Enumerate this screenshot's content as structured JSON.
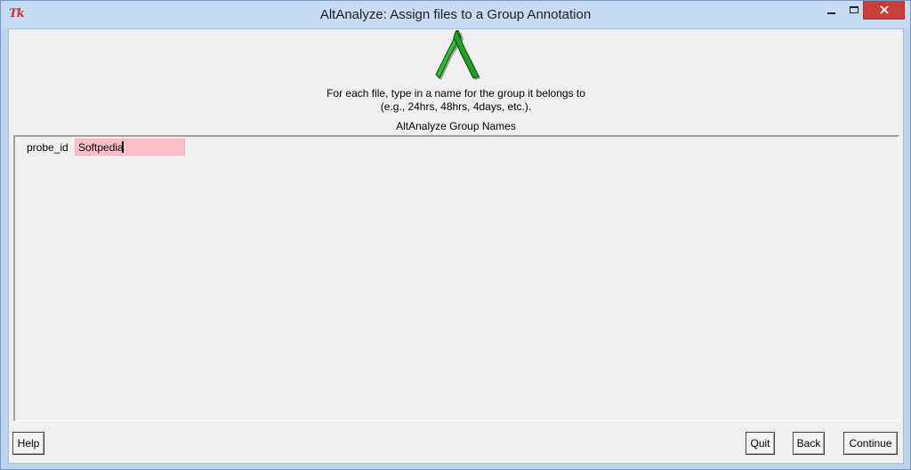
{
  "window": {
    "title": "AltAnalyze: Assign files to a Group Annotation",
    "app_icon": "tk-feather-icon",
    "icon_text": "Tk"
  },
  "header": {
    "logo": "altanalyze-logo-icon",
    "instruction_line1": "For each file, type in a name for the group it belongs to",
    "instruction_line2": "(e.g., 24hrs, 48hrs, 4days, etc.).",
    "group_heading": "AltAnalyze Group Names"
  },
  "groups": [
    {
      "label": "probe_id",
      "value": "Softpedia"
    }
  ],
  "colors": {
    "input_background": "#ffc0cb",
    "close_button": "#c7413a",
    "logo_green": "#2fbf2f"
  },
  "buttons": {
    "help": "Help",
    "quit": "Quit",
    "back": "Back",
    "continue": "Continue"
  }
}
